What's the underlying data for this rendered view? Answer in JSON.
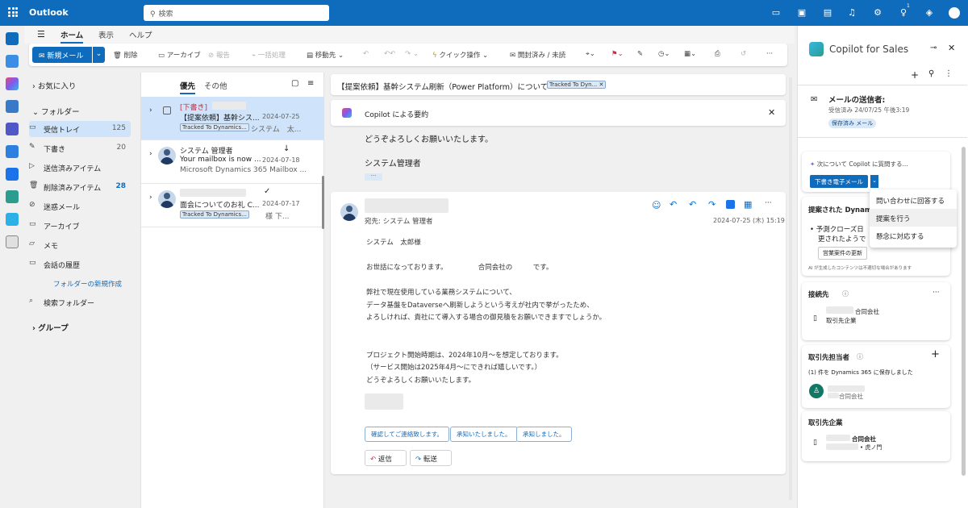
{
  "topbar": {
    "brand": "Outlook",
    "search_placeholder": "検索",
    "badge": "1"
  },
  "ribbon_tabs": [
    "ホーム",
    "表示",
    "ヘルプ"
  ],
  "ribbon": {
    "new_mail": "新規メール",
    "delete": "削除",
    "archive": "アーカイブ",
    "report": "報告",
    "sweep": "一括処理",
    "move": "移動先",
    "quick_steps": "クイック操作",
    "read_unread": "開封済み / 未読"
  },
  "folders": {
    "favorites": "お気に入り",
    "folders_header": "フォルダー",
    "items": [
      {
        "label": "受信トレイ",
        "count": "125"
      },
      {
        "label": "下書き",
        "count": "20"
      },
      {
        "label": "送信済みアイテム",
        "count": ""
      },
      {
        "label": "削除済みアイテム",
        "count": "28"
      },
      {
        "label": "迷惑メール",
        "count": ""
      },
      {
        "label": "アーカイブ",
        "count": ""
      },
      {
        "label": "メモ",
        "count": ""
      },
      {
        "label": "会話の履歴",
        "count": ""
      }
    ],
    "new_folder": "フォルダーの新規作成",
    "search_folder": "検索フォルダー",
    "groups": "グループ"
  },
  "list": {
    "tab_focused": "優先",
    "tab_other": "その他",
    "items": [
      {
        "draft": "[下書き]",
        "subject": "【提案依頼】基幹シス...",
        "date": "2024-07-25",
        "tag": "Tracked To Dynamics...",
        "preview": "システム　太..."
      },
      {
        "sender": "システム 管理者",
        "subject": "Your mailbox is now ...",
        "date": "2024-07-18",
        "preview": "Microsoft Dynamics 365 Mailbox ..."
      },
      {
        "sender": "",
        "subject": "面会についてのお礼 C...",
        "date": "2024-07-17",
        "tag": "Tracked To Dynamics...",
        "preview": "様 下..."
      }
    ]
  },
  "reading": {
    "subject": "【提案依頼】基幹システム刷新（Power Platform）について",
    "tracked_tag": "Tracked To Dyn...",
    "copilot_summary": "Copilot による要約",
    "prev_line1": "どうぞよろしくお願いいたします。",
    "prev_line2": "システム管理者",
    "to": "宛先: システム 管理者",
    "datetime": "2024-07-25 (木) 15:19",
    "body": [
      "システム　太郎様",
      "",
      "お世話になっております。　　　　　合同会社の　　　です。",
      "",
      "弊社で現在使用している業務システムについて、",
      "データ基盤をDataverseへ刷新しようという考えが社内で挙がったため、",
      "よろしければ、貴社にて導入する場合の御見積をお願いできますでしょうか。",
      "",
      "",
      "プロジェクト開始時期は、2024年10月～を想定しております。",
      "（サービス開始は2025年4月～にできれば嬉しいです。）",
      "どうぞよろしくお願いいたします。"
    ],
    "quick_replies": [
      "確認してご連絡致します。",
      "承知いたしました。",
      "承知しました。"
    ],
    "reply": "返信",
    "forward": "転送"
  },
  "copilot": {
    "title": "Copilot for Sales",
    "sender_title": "メールの送信者:",
    "received": "受信済み 24/07/25 午後3:19",
    "saved": "保存済み メール",
    "ask": "次について Copilot に質問する...",
    "draft_btn": "下書き電子メール",
    "suggest_title": "提案された Dynam",
    "suggest_text1": "• 予測クローズ日",
    "suggest_text2": "更されたようで",
    "update_btn": "営業案件の更新",
    "ai_note": "AI が生成したコンテンツは不適切な場合があります",
    "contacts_title": "接続先",
    "contacts_company": "合同会社",
    "contacts_sub": "取引先企業",
    "rep_title": "取引先担当者",
    "rep_note": "(1) 件を Dynamics 365 に保存しました",
    "rep_company": "合同会社",
    "acct_title": "取引先企業",
    "acct_company": "合同会社",
    "acct_loc": "• 虎ノ門",
    "menu": [
      "問い合わせに回答する",
      "提案を行う",
      "懸念に対応する"
    ]
  }
}
